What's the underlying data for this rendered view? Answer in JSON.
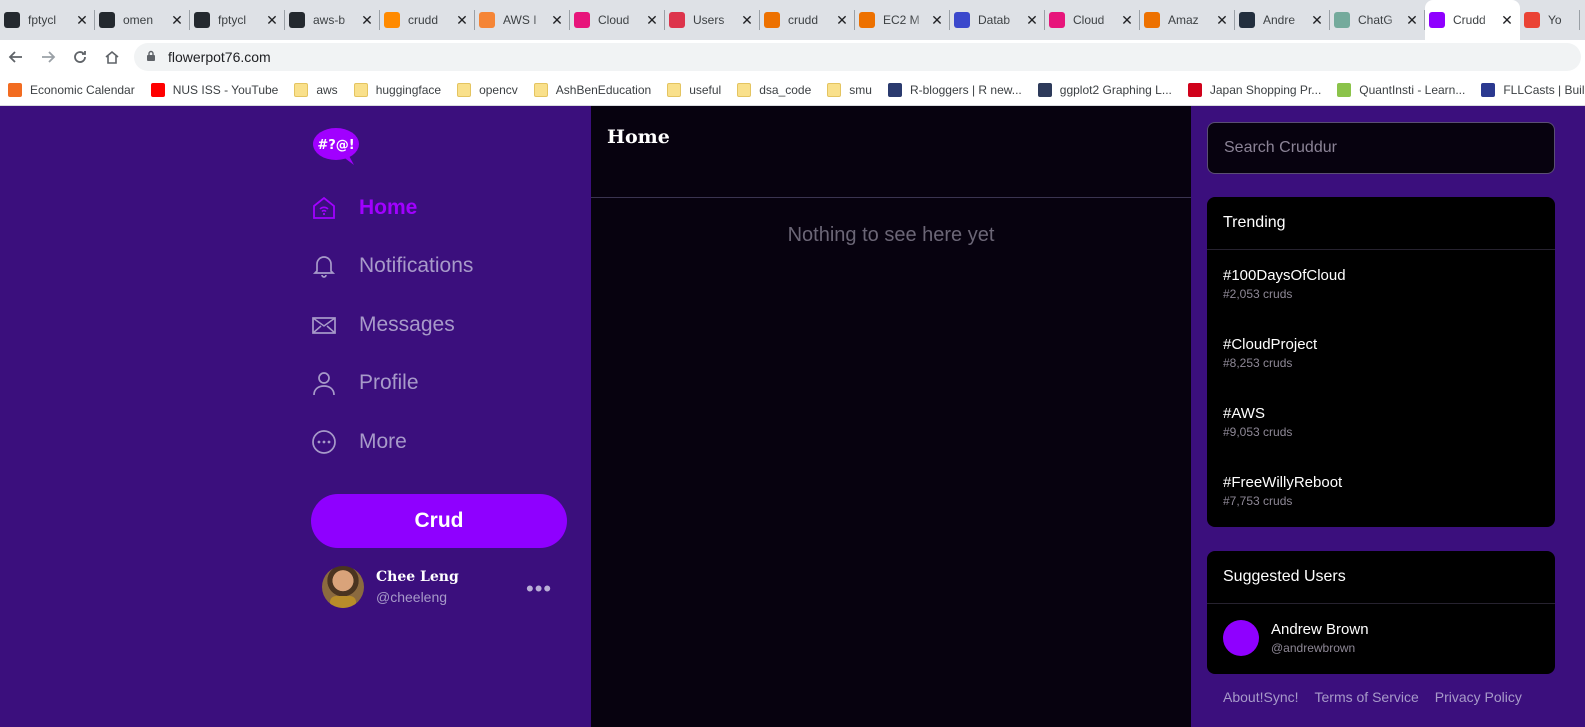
{
  "browser": {
    "tabs": [
      {
        "title": "fptycl",
        "icon": "github-icon",
        "color": "#24292f"
      },
      {
        "title": "omen",
        "icon": "github-icon",
        "color": "#24292f"
      },
      {
        "title": "fptycl",
        "icon": "github-icon",
        "color": "#24292f"
      },
      {
        "title": "aws-b",
        "icon": "github-icon",
        "color": "#24292f"
      },
      {
        "title": "crudd",
        "icon": "gitpod-icon",
        "color": "#ff8a00"
      },
      {
        "title": "AWS I",
        "icon": "aws-icon",
        "color": "#f58536"
      },
      {
        "title": "Cloud",
        "icon": "cloud-icon",
        "color": "#e7157b"
      },
      {
        "title": "Users",
        "icon": "users-icon",
        "color": "#dd344c"
      },
      {
        "title": "crudd",
        "icon": "lambda-icon",
        "color": "#ed7100"
      },
      {
        "title": "EC2 M",
        "icon": "ec2-icon",
        "color": "#ed7100"
      },
      {
        "title": "Datab",
        "icon": "database-icon",
        "color": "#3b48cc"
      },
      {
        "title": "Cloud",
        "icon": "cloud-icon",
        "color": "#e7157b"
      },
      {
        "title": "Amaz",
        "icon": "amazon-icon",
        "color": "#ed7100"
      },
      {
        "title": "Andre",
        "icon": "andrew-icon",
        "color": "#232f3e"
      },
      {
        "title": "ChatG",
        "icon": "chatgpt-icon",
        "color": "#74aa9c"
      },
      {
        "title": "Crudd",
        "icon": "cruddur-icon",
        "color": "#8f00ff",
        "active": true
      },
      {
        "title": "Yo",
        "icon": "gmail-icon",
        "color": "#ea4335"
      }
    ],
    "url": "flowerpot76.com",
    "bookmarks": [
      {
        "label": "Economic Calendar",
        "icon": "fx-icon",
        "color": "#f26c21"
      },
      {
        "label": "NUS ISS - YouTube",
        "icon": "youtube-icon",
        "color": "#ff0000"
      },
      {
        "label": "aws",
        "icon": "folder-icon",
        "folder": true
      },
      {
        "label": "huggingface",
        "icon": "folder-icon",
        "folder": true
      },
      {
        "label": "opencv",
        "icon": "folder-icon",
        "folder": true
      },
      {
        "label": "AshBenEducation",
        "icon": "folder-icon",
        "folder": true
      },
      {
        "label": "useful",
        "icon": "folder-icon",
        "folder": true
      },
      {
        "label": "dsa_code",
        "icon": "folder-icon",
        "folder": true
      },
      {
        "label": "smu",
        "icon": "folder-icon",
        "folder": true
      },
      {
        "label": "R-bloggers | R new...",
        "icon": "rbloggers-icon",
        "color": "#2a3a6e"
      },
      {
        "label": "ggplot2 Graphing L...",
        "icon": "chart-icon",
        "color": "#2d3a5a"
      },
      {
        "label": "Japan Shopping Pr...",
        "icon": "japan-icon",
        "color": "#d0021b"
      },
      {
        "label": "QuantInsti - Learn...",
        "icon": "quantinsti-icon",
        "color": "#8bc34a"
      },
      {
        "label": "FLLCasts | Buildi",
        "icon": "fllcasts-icon",
        "color": "#2b3990"
      }
    ]
  },
  "app": {
    "logo_text": "#?@!",
    "nav": [
      {
        "label": "Home",
        "icon": "home-icon",
        "active": true
      },
      {
        "label": "Notifications",
        "icon": "bell-icon"
      },
      {
        "label": "Messages",
        "icon": "mail-icon"
      },
      {
        "label": "Profile",
        "icon": "user-icon"
      },
      {
        "label": "More",
        "icon": "more-circle-icon"
      }
    ],
    "crud_button": "Crud",
    "user": {
      "name": "Chee Leng",
      "handle": "@cheeleng",
      "more": "•••"
    },
    "feed": {
      "title": "Home",
      "empty": "Nothing to see here yet"
    },
    "search": {
      "placeholder": "Search Cruddur"
    },
    "trending": {
      "title": "Trending",
      "items": [
        {
          "tag": "#100DaysOfCloud",
          "count": "#2,053 cruds"
        },
        {
          "tag": "#CloudProject",
          "count": "#8,253 cruds"
        },
        {
          "tag": "#AWS",
          "count": "#9,053 cruds"
        },
        {
          "tag": "#FreeWillyReboot",
          "count": "#7,753 cruds"
        }
      ]
    },
    "suggested": {
      "title": "Suggested Users",
      "users": [
        {
          "name": "Andrew Brown",
          "handle": "@andrewbrown"
        }
      ]
    },
    "footer": [
      "About!Sync!",
      "Terms of Service",
      "Privacy Policy"
    ],
    "colors": {
      "accent": "#8f00ff",
      "sidebar_bg": "#3b0f7d",
      "feed_bg": "#07020f"
    }
  }
}
